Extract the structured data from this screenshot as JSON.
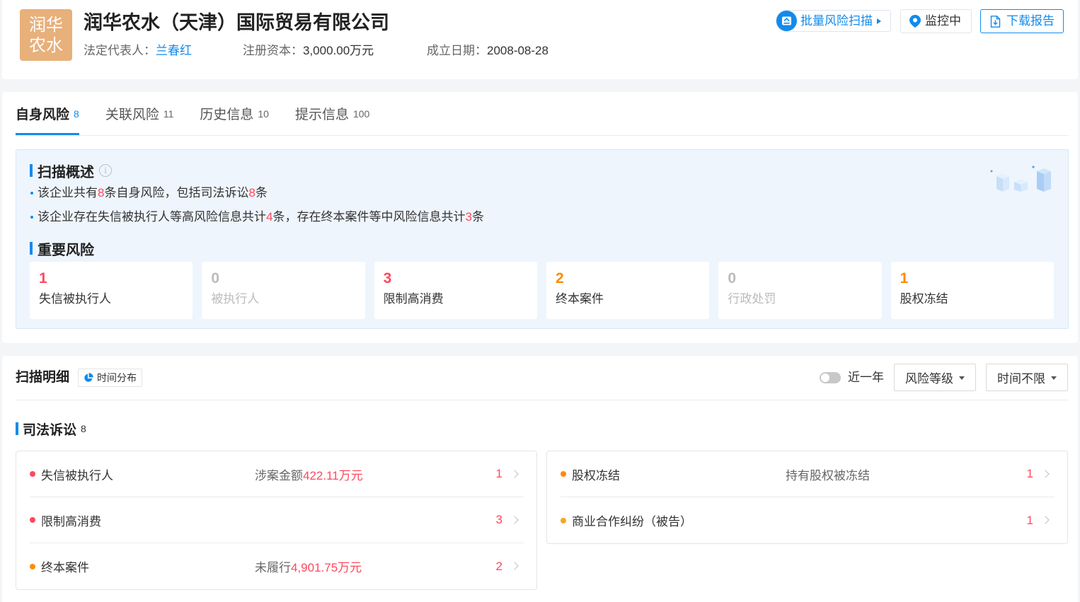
{
  "theme": {
    "primary": "#128bed",
    "red": "#fd485e",
    "orange": "#ff8a00",
    "yellow": "#f5a623",
    "muted": "#bbbbbb",
    "logo_bg": "#e8b07a"
  },
  "header": {
    "logo": {
      "line1": "润华",
      "line2": "农水"
    },
    "company_name": "润华农水（天津）国际贸易有限公司",
    "legal_rep": {
      "label": "法定代表人：",
      "value": "兰春红"
    },
    "registered_capital": {
      "label": "注册资本：",
      "value": "3,000.00万元"
    },
    "founded_date": {
      "label": "成立日期：",
      "value": "2008-08-28"
    },
    "actions": {
      "batch_scan": {
        "label": "批量风险扫描",
        "icon": "batch-scan-icon"
      },
      "monitor": {
        "label": "监控中",
        "icon": "location-pin-icon"
      },
      "download": {
        "label": "下载报告",
        "icon": "document-download-icon"
      }
    }
  },
  "tabs": [
    {
      "label": "自身风险",
      "count": "8",
      "active": true
    },
    {
      "label": "关联风险",
      "count": "11",
      "active": false
    },
    {
      "label": "历史信息",
      "count": "10",
      "active": false
    },
    {
      "label": "提示信息",
      "count": "100",
      "active": false
    }
  ],
  "summary": {
    "title": "扫描概述",
    "lines": [
      {
        "t1": "该企业共有",
        "n1": "8",
        "t2": "条自身风险，包括司法诉讼",
        "n2": "8",
        "t3": "条"
      },
      {
        "t1": "该企业存在失信被执行人等高风险信息共计",
        "n1": "4",
        "t2": "条，存在终本案件等中风险信息共计",
        "n2": "3",
        "t3": "条"
      }
    ]
  },
  "key_risks": {
    "title": "重要风险",
    "items": [
      {
        "count": "1",
        "label": "失信被执行人",
        "count_color": "#fd485e",
        "label_color": "#333333"
      },
      {
        "count": "0",
        "label": "被执行人",
        "count_color": "#bbbbbb",
        "label_color": "#bbbbbb"
      },
      {
        "count": "3",
        "label": "限制高消费",
        "count_color": "#fd485e",
        "label_color": "#333333"
      },
      {
        "count": "2",
        "label": "终本案件",
        "count_color": "#ff8a00",
        "label_color": "#333333"
      },
      {
        "count": "0",
        "label": "行政处罚",
        "count_color": "#bbbbbb",
        "label_color": "#bbbbbb"
      },
      {
        "count": "1",
        "label": "股权冻结",
        "count_color": "#ff8a00",
        "label_color": "#333333"
      }
    ]
  },
  "details": {
    "title": "扫描明细",
    "time_dist_tag": {
      "label": "时间分布",
      "icon": "pie-chart-icon"
    },
    "recent_year_toggle": {
      "label": "近一年",
      "on": false
    },
    "filters": [
      {
        "label": "风险等级"
      },
      {
        "label": "时间不限"
      }
    ],
    "section": {
      "title": "司法诉讼",
      "count": "8",
      "left": [
        {
          "label": "失信被执行人",
          "desc_prefix": "涉案金额",
          "desc_value": "422.11万元",
          "count": "1",
          "dot_color": "#fd485e",
          "count_color": "#fd485e"
        },
        {
          "label": "限制高消费",
          "count": "3",
          "dot_color": "#fd485e",
          "count_color": "#fd485e"
        },
        {
          "label": "终本案件",
          "desc_prefix": "未履行",
          "desc_value": "4,901.75万元",
          "count": "2",
          "dot_color": "#ff8a00",
          "count_color": "#fd485e"
        }
      ],
      "right": [
        {
          "label": "股权冻结",
          "desc_prefix": "持有股权被冻结",
          "count": "1",
          "dot_color": "#ff8a00",
          "count_color": "#fd485e"
        },
        {
          "label": "商业合作纠纷（被告）",
          "count": "1",
          "dot_color": "#f5a623",
          "count_color": "#fd485e"
        }
      ]
    }
  }
}
